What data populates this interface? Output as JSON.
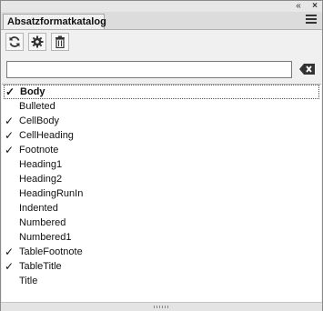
{
  "titlebar": {
    "collapse_icon": "double-chevron-left-icon",
    "close_icon": "close-icon"
  },
  "tab": {
    "label": "Absatzformatkatalog"
  },
  "toolbar": {
    "tools": [
      "refresh-icon",
      "gear-icon",
      "delete-icon"
    ]
  },
  "search": {
    "value": "",
    "placeholder": ""
  },
  "list": {
    "check_mark": "✓",
    "items": [
      {
        "label": "Body",
        "checked": true,
        "selected": true
      },
      {
        "label": "Bulleted",
        "checked": false
      },
      {
        "label": "CellBody",
        "checked": true
      },
      {
        "label": "CellHeading",
        "checked": true
      },
      {
        "label": "Footnote",
        "checked": true
      },
      {
        "label": "Heading1",
        "checked": false
      },
      {
        "label": "Heading2",
        "checked": false
      },
      {
        "label": "HeadingRunIn",
        "checked": false
      },
      {
        "label": "Indented",
        "checked": false
      },
      {
        "label": "Numbered",
        "checked": false
      },
      {
        "label": "Numbered1",
        "checked": false
      },
      {
        "label": "TableFootnote",
        "checked": true
      },
      {
        "label": "TableTitle",
        "checked": true
      },
      {
        "label": "Title",
        "checked": false
      }
    ]
  }
}
